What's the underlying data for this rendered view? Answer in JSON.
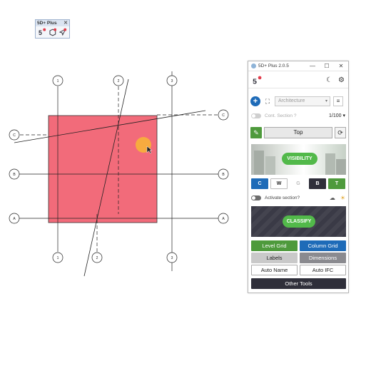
{
  "toolbar": {
    "title": "5D+ Plus",
    "close": "✕",
    "icons": [
      "5d-logo-icon",
      "cube-add-icon",
      "pointer-add-icon"
    ]
  },
  "drawing": {
    "grid_labels": {
      "col1_top": "1",
      "col2_top": "2",
      "col3_top": "3",
      "col1_bot": "1",
      "col2_bot": "2",
      "col3_bot": "3",
      "rowA_l": "A",
      "rowA_r": "A",
      "rowB_l": "B",
      "rowB_r": "B",
      "rowC_l": "C",
      "rowC_r": "C"
    },
    "slab_color": "#f26b7a"
  },
  "panel": {
    "title": "5D+ Plus 2.0.5",
    "win": {
      "min": "—",
      "max": "☐",
      "close": "✕"
    },
    "header_icons": {
      "moon": "☾",
      "gear": "⚙"
    },
    "add": "+",
    "expand": "⛶",
    "discipline": {
      "value": "Architecture",
      "caret": "▾"
    },
    "list_icon": "≡",
    "cont_section": "Cont. Section ?",
    "scale": "1/100 ▾",
    "view": {
      "pen": "✎",
      "label": "Top",
      "refresh": "⟳"
    },
    "visibility": "VISIBILITY",
    "cw": {
      "c": "C",
      "w": "W",
      "g": "G",
      "b": "B",
      "t": "T"
    },
    "activate_section": "Activate section?",
    "cloud": "☁",
    "sun": "☀",
    "classify": "CLASSIFY",
    "buttons": {
      "level_grid": "Level Grid",
      "column_grid": "Column Grid",
      "labels": "Labels",
      "dimensions": "Dimensions",
      "auto_name": "Auto Name",
      "auto_ifc": "Auto IFC",
      "other_tools": "Other Tools"
    },
    "colors": {
      "blue": "#1e6bb8",
      "green": "#4e9a3c",
      "navy": "#2f2f3a",
      "pill": "#52b94a"
    }
  }
}
